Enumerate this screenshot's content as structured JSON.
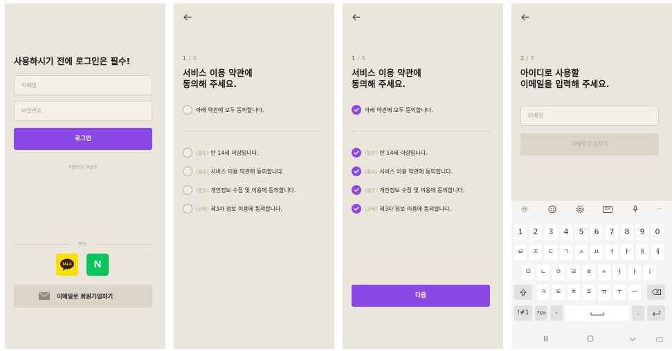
{
  "screen1": {
    "title": "사용하시기 전에 로그인은 필수!",
    "email_placeholder": "이메일",
    "password_placeholder": "비밀번호",
    "login_label": "로그인",
    "reset_password_label": "비밀번호 재설정",
    "or_label": "또는",
    "kakao_text": "TALK",
    "naver_text": "N",
    "email_signup_label": "이메일로 회원가입하기"
  },
  "screen2": {
    "step_current": "1",
    "step_total": "/ 5",
    "title_line1": "서비스 이용 약관에",
    "title_line2": "동의해 주세요.",
    "agree_all": "아래 약관에 모두 동의합니다.",
    "items": [
      {
        "tag": "(필수)",
        "label": "만 14세 이상입니다.",
        "checked": false
      },
      {
        "tag": "(필수)",
        "label": "서비스 이용 약관에 동의합니다.",
        "checked": false
      },
      {
        "tag": "(필수)",
        "label": "개인정보 수집 및 이용에 동의합니다.",
        "checked": false
      },
      {
        "tag": "(선택)",
        "label": "제3자 정보 이용에 동의합니다.",
        "checked": false
      }
    ]
  },
  "screen3": {
    "step_current": "1",
    "step_total": "/ 5",
    "title_line1": "서비스 이용 약관에",
    "title_line2": "동의해 주세요.",
    "agree_all": "아래 약관에 모두 동의합니다.",
    "items": [
      {
        "tag": "(필수)",
        "label": "만 14세 이상입니다.",
        "checked": true
      },
      {
        "tag": "(필수)",
        "label": "서비스 이용 약관에 동의합니다.",
        "checked": true
      },
      {
        "tag": "(필수)",
        "label": "개인정보 수집 및 이용에 동의합니다.",
        "checked": true
      },
      {
        "tag": "(선택)",
        "label": "제3자 정보 이용에 동의합니다.",
        "checked": true
      }
    ],
    "next_label": "다음"
  },
  "screen4": {
    "step_current": "2",
    "step_total": "/ 5",
    "title_line1": "아이디로 사용할",
    "title_line2": "이메일을 입력해 주세요.",
    "email_placeholder": "이메일",
    "verify_label": "이메일 인증하기",
    "keyboard": {
      "toolbar": [
        "sticker-icon",
        "emoji-icon",
        "settings-icon",
        "gif-icon",
        "mic-icon",
        "more-icon"
      ],
      "more_label": "···",
      "gif_label": "GIF",
      "numbers": [
        "1",
        "2",
        "3",
        "4",
        "5",
        "6",
        "7",
        "8",
        "9",
        "0"
      ],
      "row1": [
        "ㅂ",
        "ㅈ",
        "ㄷ",
        "ㄱ",
        "ㅅ",
        "ㅛ",
        "ㅕ",
        "ㅑ",
        "ㅐ",
        "ㅔ"
      ],
      "row2": [
        "ㅁ",
        "ㄴ",
        "ㅇ",
        "ㄹ",
        "ㅎ",
        "ㅗ",
        "ㅓ",
        "ㅏ",
        "ㅣ"
      ],
      "row3": [
        "ㅋ",
        "ㅌ",
        "ㅊ",
        "ㅍ",
        "ㅠ",
        "ㅜ",
        "ㅡ"
      ],
      "sym_label": "!#1",
      "lang_label": "가/a",
      "dash_label": "-",
      "period_label": "."
    }
  },
  "colors": {
    "background": "#ebe6dc",
    "accent": "#8a48e5",
    "kakao": "#f9e000",
    "naver": "#03c75a"
  }
}
